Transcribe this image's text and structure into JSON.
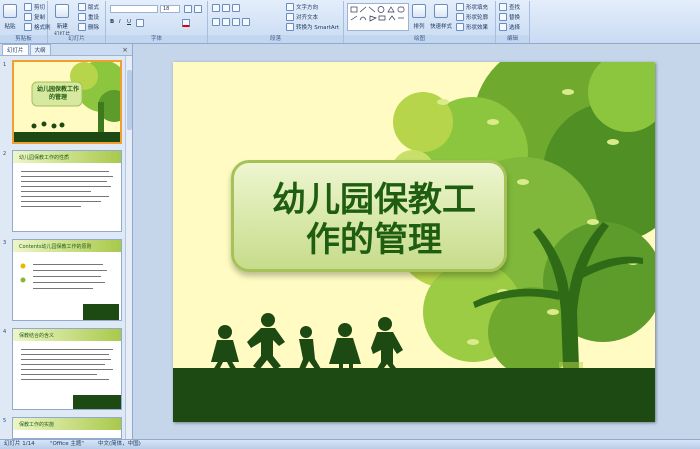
{
  "ribbon": {
    "groups": [
      "剪贴板",
      "幻灯片",
      "字体",
      "段落",
      "绘图",
      "编辑"
    ],
    "clipboard": {
      "paste": "粘贴",
      "cut": "剪切",
      "copy": "复制",
      "format_painter": "格式刷"
    },
    "slides": {
      "new_slide": "新建\n幻灯片",
      "layout": "版式",
      "reset": "重设",
      "delete": "删除"
    },
    "font": {
      "font_name": "",
      "font_size": "18"
    },
    "paragraph": {
      "text_direction": "文字方向",
      "align_text": "对齐文本",
      "smartart": "转换为 SmartArt"
    },
    "drawing": {
      "arrange": "排列",
      "quick_styles": "快速样式",
      "shape_fill": "形状填充",
      "shape_outline": "形状轮廓",
      "shape_effects": "形状效果"
    },
    "editing": {
      "find": "查找",
      "replace": "替换",
      "select": "选择"
    }
  },
  "panel": {
    "tabs": [
      "幻灯片",
      "大纲"
    ],
    "slides": [
      {
        "num": "1",
        "title": "幼儿园保教工作的管理"
      },
      {
        "num": "2",
        "title": "幼儿园保教工作的性质"
      },
      {
        "num": "3",
        "title": "Contents幼儿园保教工作的原则"
      },
      {
        "num": "4",
        "title": "保教结合的含义"
      },
      {
        "num": "5",
        "title": "保教工作的实施"
      }
    ]
  },
  "slide": {
    "title_line1": "幼儿园保教工",
    "title_line2": "作的管理"
  },
  "status": {
    "slide_info": "幻灯片 1/14",
    "theme": "\"Office 主题\"",
    "language": "中文(简体，中国)"
  },
  "colors": {
    "title": "#1f5d10",
    "ground": "#1d4a12",
    "leaf_light": "#b7d54a",
    "leaf_dark": "#3d7a1e",
    "slide_bg": "#fffbc2"
  }
}
